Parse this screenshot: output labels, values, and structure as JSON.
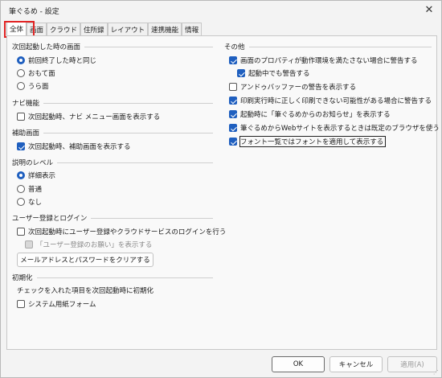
{
  "window": {
    "title": "筆ぐるめ - 設定",
    "close_glyph": "✕"
  },
  "tabs": [
    {
      "label": "全体",
      "active": true
    },
    {
      "label": "画面",
      "active": false
    },
    {
      "label": "クラウド",
      "active": false
    },
    {
      "label": "住所録",
      "active": false
    },
    {
      "label": "レイアウト",
      "active": false
    },
    {
      "label": "連携機能",
      "active": false
    },
    {
      "label": "情報",
      "active": false
    }
  ],
  "left": {
    "startup": {
      "heading": "次回起動した時の画面",
      "options": [
        {
          "label": "前回終了した時と同じ",
          "checked": true
        },
        {
          "label": "おもて面",
          "checked": false
        },
        {
          "label": "うら面",
          "checked": false
        }
      ]
    },
    "navi": {
      "heading": "ナビ機能",
      "options": [
        {
          "label": "次回起動時、ナビ メニュー画面を表示する",
          "checked": false
        }
      ]
    },
    "assist": {
      "heading": "補助画面",
      "options": [
        {
          "label": "次回起動時、補助画面を表示する",
          "checked": true
        }
      ]
    },
    "help_level": {
      "heading": "説明のレベル",
      "options": [
        {
          "label": "詳細表示",
          "checked": true
        },
        {
          "label": "普通",
          "checked": false
        },
        {
          "label": "なし",
          "checked": false
        }
      ]
    },
    "user_reg": {
      "heading": "ユーザー登録とログイン",
      "options": [
        {
          "label": "次回起動時にユーザー登録やクラウドサービスのログインを行う",
          "checked": false
        },
        {
          "label": "「ユーザー登録のお願い」を表示する",
          "checked": false,
          "disabled": true
        }
      ],
      "clear_button": "メールアドレスとパスワードをクリアする"
    },
    "init": {
      "heading": "初期化",
      "description": "チェックを入れた項目を次回起動時に初期化",
      "options": [
        {
          "label": "システム用紙フォーム",
          "checked": false
        }
      ]
    }
  },
  "right": {
    "heading": "その他",
    "options": [
      {
        "label": "画面のプロパティが動作環境を満たさない場合に警告する",
        "checked": true
      },
      {
        "label": "起動中でも警告する",
        "checked": true
      },
      {
        "label": "アンドゥバッファーの警告を表示する",
        "checked": false
      },
      {
        "label": "印刷実行時に正しく印刷できない可能性がある場合に警告する",
        "checked": true
      },
      {
        "label": "起動時に「筆ぐるめからのお知らせ」を表示する",
        "checked": true
      },
      {
        "label": "筆ぐるめからWebサイトを表示するときは既定のブラウザを使う",
        "checked": true
      },
      {
        "label": "フォント一覧ではフォントを適用して表示する",
        "checked": true
      }
    ]
  },
  "footer": {
    "ok": "OK",
    "cancel": "キャンセル",
    "apply": "適用(A)"
  },
  "colors": {
    "accent": "#1f5fbf",
    "highlight": "#e12323"
  }
}
